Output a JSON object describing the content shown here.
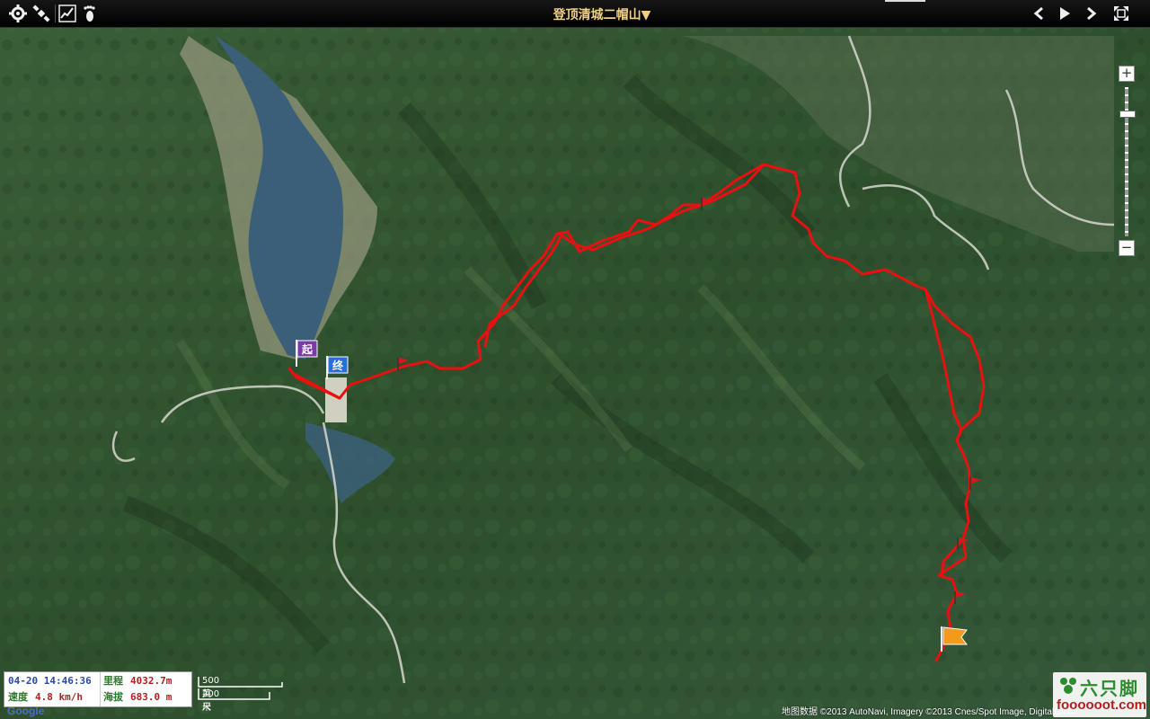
{
  "toolbar": {
    "title": "登顶清城二帽山",
    "title_caret": "▼",
    "left_icons": [
      "settings-icon",
      "satellite-icon",
      "track-chart-icon",
      "footprint-icon"
    ],
    "right_icons": [
      "prev-icon",
      "play-icon",
      "next-icon",
      "fullscreen-icon"
    ]
  },
  "zoom": {
    "plus": "+",
    "minus": "−"
  },
  "markers": {
    "start_label": "起",
    "end_label": "终"
  },
  "info": {
    "time": "04-20 14:46:36",
    "distance_label": "里程",
    "distance_value": "4032.7m",
    "speed_label": "速度",
    "speed_value": "4.8 km/h",
    "altitude_label": "海拔",
    "altitude_value": "683.0 m"
  },
  "scale": {
    "imperial": "500 英尺",
    "metric": "200 米"
  },
  "credit": "地图数据 ©2013 AutoNavi, Imagery ©2013 Cnes/Spot Image, DigitalGlobe",
  "logo": {
    "cn": "六只脚",
    "en": "foooooot.com"
  },
  "google": "Google",
  "colors": {
    "track": "#e81010",
    "forest": "#2f5230",
    "water": "#3b5f78",
    "title": "#f0d080"
  }
}
